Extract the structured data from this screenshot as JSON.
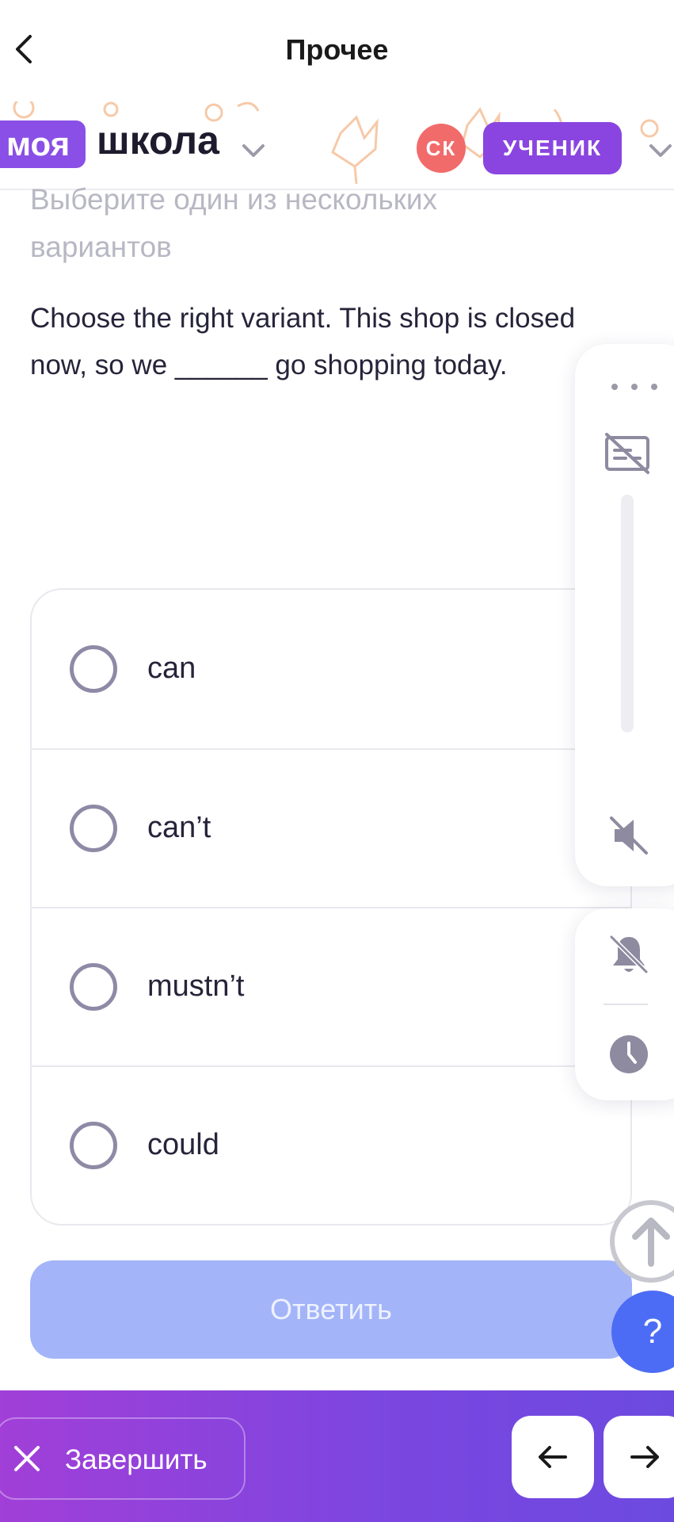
{
  "topbar": {
    "title": "Прочее"
  },
  "school_header": {
    "logo_part1": "моя",
    "logo_part2": "школа",
    "avatar_initials": "СК",
    "role": "УЧЕНИК"
  },
  "task": {
    "instruction": "Выберите один из нескольких вариантов",
    "question": "Choose the right variant. This shop is closed now, so we ______ go shopping today.",
    "options": [
      {
        "label": "can",
        "selected": false
      },
      {
        "label": "can’t",
        "selected": false
      },
      {
        "label": "mustn’t",
        "selected": false
      },
      {
        "label": "could",
        "selected": false
      }
    ],
    "submit_label": "Ответить"
  },
  "side_panel": {
    "icons": [
      "more-dots-icon",
      "subtitles-off-icon",
      "volume-muted-icon",
      "bell-off-icon",
      "clock-icon"
    ],
    "volume_level": 0
  },
  "floating": {
    "help_label": "?"
  },
  "bottom_bar": {
    "finish_label": "Завершить"
  },
  "colors": {
    "brand_purple": "#8a45e0",
    "avatar_red": "#f26b6b",
    "submit_disabled": "#a3b5f8",
    "help_blue": "#4d6cf5"
  }
}
